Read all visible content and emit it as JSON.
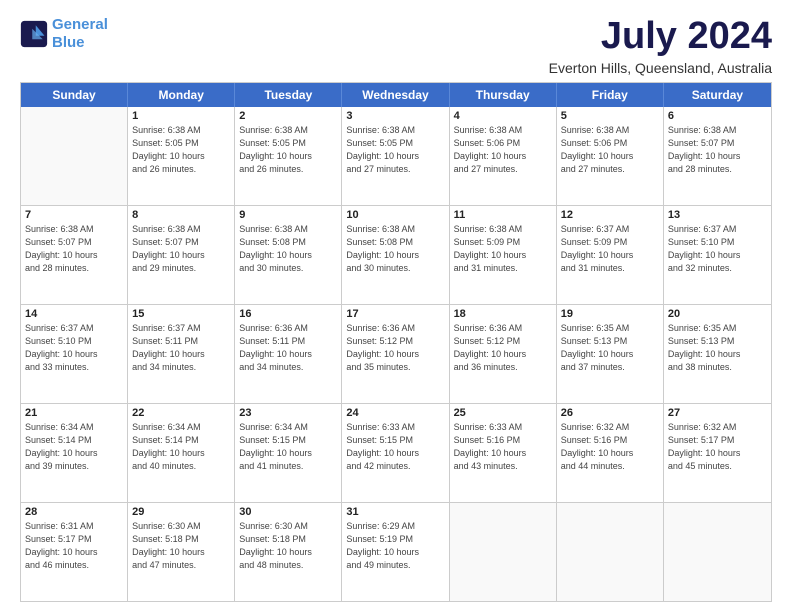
{
  "logo": {
    "line1": "General",
    "line2": "Blue"
  },
  "title": "July 2024",
  "subtitle": "Everton Hills, Queensland, Australia",
  "weekdays": [
    "Sunday",
    "Monday",
    "Tuesday",
    "Wednesday",
    "Thursday",
    "Friday",
    "Saturday"
  ],
  "weeks": [
    [
      {
        "day": "",
        "info": ""
      },
      {
        "day": "1",
        "info": "Sunrise: 6:38 AM\nSunset: 5:05 PM\nDaylight: 10 hours\nand 26 minutes."
      },
      {
        "day": "2",
        "info": "Sunrise: 6:38 AM\nSunset: 5:05 PM\nDaylight: 10 hours\nand 26 minutes."
      },
      {
        "day": "3",
        "info": "Sunrise: 6:38 AM\nSunset: 5:05 PM\nDaylight: 10 hours\nand 27 minutes."
      },
      {
        "day": "4",
        "info": "Sunrise: 6:38 AM\nSunset: 5:06 PM\nDaylight: 10 hours\nand 27 minutes."
      },
      {
        "day": "5",
        "info": "Sunrise: 6:38 AM\nSunset: 5:06 PM\nDaylight: 10 hours\nand 27 minutes."
      },
      {
        "day": "6",
        "info": "Sunrise: 6:38 AM\nSunset: 5:07 PM\nDaylight: 10 hours\nand 28 minutes."
      }
    ],
    [
      {
        "day": "7",
        "info": "Sunrise: 6:38 AM\nSunset: 5:07 PM\nDaylight: 10 hours\nand 28 minutes."
      },
      {
        "day": "8",
        "info": "Sunrise: 6:38 AM\nSunset: 5:07 PM\nDaylight: 10 hours\nand 29 minutes."
      },
      {
        "day": "9",
        "info": "Sunrise: 6:38 AM\nSunset: 5:08 PM\nDaylight: 10 hours\nand 30 minutes."
      },
      {
        "day": "10",
        "info": "Sunrise: 6:38 AM\nSunset: 5:08 PM\nDaylight: 10 hours\nand 30 minutes."
      },
      {
        "day": "11",
        "info": "Sunrise: 6:38 AM\nSunset: 5:09 PM\nDaylight: 10 hours\nand 31 minutes."
      },
      {
        "day": "12",
        "info": "Sunrise: 6:37 AM\nSunset: 5:09 PM\nDaylight: 10 hours\nand 31 minutes."
      },
      {
        "day": "13",
        "info": "Sunrise: 6:37 AM\nSunset: 5:10 PM\nDaylight: 10 hours\nand 32 minutes."
      }
    ],
    [
      {
        "day": "14",
        "info": "Sunrise: 6:37 AM\nSunset: 5:10 PM\nDaylight: 10 hours\nand 33 minutes."
      },
      {
        "day": "15",
        "info": "Sunrise: 6:37 AM\nSunset: 5:11 PM\nDaylight: 10 hours\nand 34 minutes."
      },
      {
        "day": "16",
        "info": "Sunrise: 6:36 AM\nSunset: 5:11 PM\nDaylight: 10 hours\nand 34 minutes."
      },
      {
        "day": "17",
        "info": "Sunrise: 6:36 AM\nSunset: 5:12 PM\nDaylight: 10 hours\nand 35 minutes."
      },
      {
        "day": "18",
        "info": "Sunrise: 6:36 AM\nSunset: 5:12 PM\nDaylight: 10 hours\nand 36 minutes."
      },
      {
        "day": "19",
        "info": "Sunrise: 6:35 AM\nSunset: 5:13 PM\nDaylight: 10 hours\nand 37 minutes."
      },
      {
        "day": "20",
        "info": "Sunrise: 6:35 AM\nSunset: 5:13 PM\nDaylight: 10 hours\nand 38 minutes."
      }
    ],
    [
      {
        "day": "21",
        "info": "Sunrise: 6:34 AM\nSunset: 5:14 PM\nDaylight: 10 hours\nand 39 minutes."
      },
      {
        "day": "22",
        "info": "Sunrise: 6:34 AM\nSunset: 5:14 PM\nDaylight: 10 hours\nand 40 minutes."
      },
      {
        "day": "23",
        "info": "Sunrise: 6:34 AM\nSunset: 5:15 PM\nDaylight: 10 hours\nand 41 minutes."
      },
      {
        "day": "24",
        "info": "Sunrise: 6:33 AM\nSunset: 5:15 PM\nDaylight: 10 hours\nand 42 minutes."
      },
      {
        "day": "25",
        "info": "Sunrise: 6:33 AM\nSunset: 5:16 PM\nDaylight: 10 hours\nand 43 minutes."
      },
      {
        "day": "26",
        "info": "Sunrise: 6:32 AM\nSunset: 5:16 PM\nDaylight: 10 hours\nand 44 minutes."
      },
      {
        "day": "27",
        "info": "Sunrise: 6:32 AM\nSunset: 5:17 PM\nDaylight: 10 hours\nand 45 minutes."
      }
    ],
    [
      {
        "day": "28",
        "info": "Sunrise: 6:31 AM\nSunset: 5:17 PM\nDaylight: 10 hours\nand 46 minutes."
      },
      {
        "day": "29",
        "info": "Sunrise: 6:30 AM\nSunset: 5:18 PM\nDaylight: 10 hours\nand 47 minutes."
      },
      {
        "day": "30",
        "info": "Sunrise: 6:30 AM\nSunset: 5:18 PM\nDaylight: 10 hours\nand 48 minutes."
      },
      {
        "day": "31",
        "info": "Sunrise: 6:29 AM\nSunset: 5:19 PM\nDaylight: 10 hours\nand 49 minutes."
      },
      {
        "day": "",
        "info": ""
      },
      {
        "day": "",
        "info": ""
      },
      {
        "day": "",
        "info": ""
      }
    ]
  ]
}
